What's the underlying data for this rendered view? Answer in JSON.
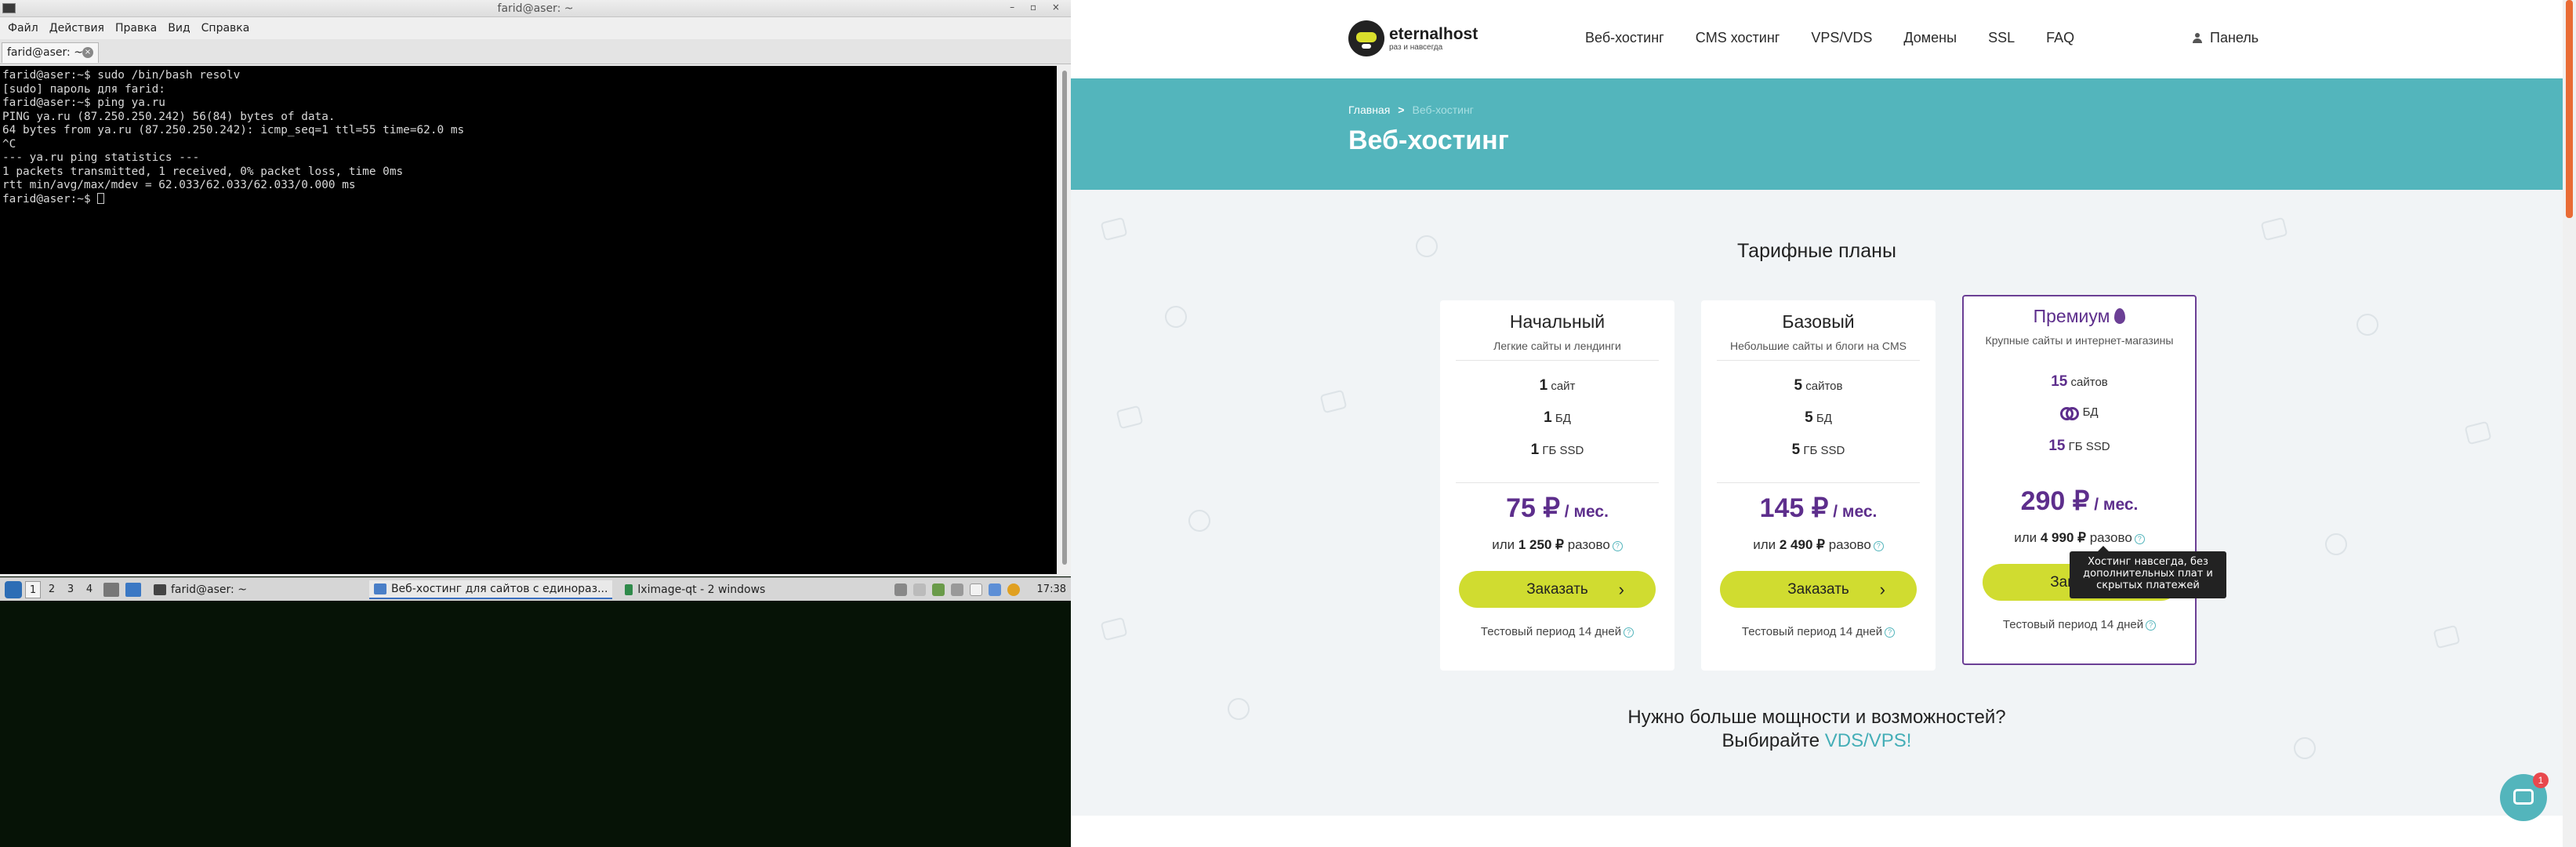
{
  "terminal_window": {
    "title": "farid@aser: ~",
    "menu": [
      "Файл",
      "Действия",
      "Правка",
      "Вид",
      "Справка"
    ],
    "tab_label": "farid@aser: ~",
    "lines": [
      "farid@aser:~$ sudo /bin/bash resolv",
      "[sudo] пароль для farid:",
      "farid@aser:~$ ping ya.ru",
      "PING ya.ru (87.250.250.242) 56(84) bytes of data.",
      "64 bytes from ya.ru (87.250.250.242): icmp_seq=1 ttl=55 time=62.0 ms",
      "^C",
      "--- ya.ru ping statistics ---",
      "1 packets transmitted, 1 received, 0% packet loss, time 0ms",
      "rtt min/avg/max/mdev = 62.033/62.033/62.033/0.000 ms"
    ],
    "prompt": "farid@aser:~$ "
  },
  "taskbar": {
    "desktops": [
      "1",
      "2",
      "3",
      "4"
    ],
    "tasks": [
      {
        "label": "farid@aser: ~"
      },
      {
        "label": "Веб-хостинг для сайтов с единораз..."
      },
      {
        "label": "lximage-qt - 2 windows"
      }
    ],
    "clock": "17:38"
  },
  "site": {
    "logo_name": "eternalhost",
    "logo_tagline": "раз и навсегда",
    "nav": [
      "Веб-хостинг",
      "CMS хостинг",
      "VPS/VDS",
      "Домены",
      "SSL",
      "FAQ"
    ],
    "panel_label": "Панель",
    "breadcrumb_home": "Главная",
    "breadcrumb_sep": ">",
    "breadcrumb_current": "Веб-хостинг",
    "hero_title": "Веб-хостинг",
    "plans_title": "Тарифные планы",
    "plans": [
      {
        "name": "Начальный",
        "subtitle": "Легкие сайты и лендинги",
        "sites_n": "1",
        "sites_label": "сайт",
        "db_n": "1",
        "db_label": "БД",
        "ssd_n": "1",
        "ssd_label": "ГБ SSD",
        "price": "75 ₽",
        "price_unit": " / мес.",
        "once_prefix": "или",
        "once_price": "1 250 ₽",
        "once_suffix": "разово",
        "order_label": "Заказать",
        "trial": "Тестовый период 14 дней"
      },
      {
        "name": "Базовый",
        "subtitle": "Небольшие сайты и блоги на CMS",
        "sites_n": "5",
        "sites_label": "сайтов",
        "db_n": "5",
        "db_label": "БД",
        "ssd_n": "5",
        "ssd_label": "ГБ SSD",
        "price": "145 ₽",
        "price_unit": " / мес.",
        "once_prefix": "или",
        "once_price": "2 490 ₽",
        "once_suffix": "разово",
        "order_label": "Заказать",
        "trial": "Тестовый период 14 дней"
      },
      {
        "name": "Премиум",
        "subtitle": "Крупные сайты и интернет-магазины",
        "sites_n": "15",
        "sites_label": "сайтов",
        "db_n": "∞",
        "db_label": "БД",
        "ssd_n": "15",
        "ssd_label": "ГБ SSD",
        "price": "290 ₽",
        "price_unit": " / мес.",
        "once_prefix": "или",
        "once_price": "4 990 ₽",
        "once_suffix": "разово",
        "order_label": "Заказать",
        "trial": "Тестовый период 14 дней"
      }
    ],
    "tooltip": "Хостинг навсегда, без дополнительных плат и скрытых платежей",
    "more_line1": "Нужно больше мощности и возможностей?",
    "more_line2_prefix": "Выбирайте ",
    "more_line2_link": "VDS/VPS!",
    "chat_badge": "1"
  },
  "colors": {
    "accent_teal": "#53b5bc",
    "premium_purple": "#6b3f95",
    "order_lime": "#d0dc30",
    "scroll_orange": "#e96b34"
  }
}
